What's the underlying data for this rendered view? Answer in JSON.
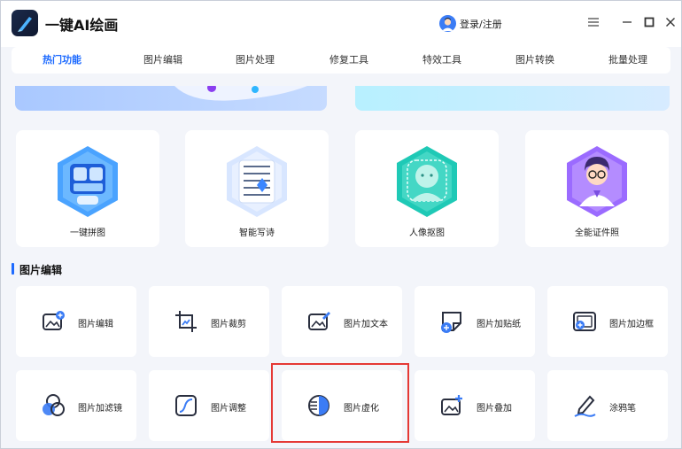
{
  "app": {
    "title": "一键AI绘画",
    "login_label": "登录/注册"
  },
  "nav": {
    "tabs": [
      {
        "label": "热门功能"
      },
      {
        "label": "图片编辑"
      },
      {
        "label": "图片处理"
      },
      {
        "label": "修复工具"
      },
      {
        "label": "特效工具"
      },
      {
        "label": "图片转换"
      },
      {
        "label": "批量处理"
      }
    ],
    "active_index": 0
  },
  "features": [
    {
      "label": "一键拼图",
      "icon": "collage-icon"
    },
    {
      "label": "智能写诗",
      "icon": "poem-icon"
    },
    {
      "label": "人像抠图",
      "icon": "portrait-cutout-icon"
    },
    {
      "label": "全能证件照",
      "icon": "id-photo-icon"
    }
  ],
  "section": {
    "title": "图片编辑"
  },
  "tools": [
    {
      "label": "图片编辑",
      "icon": "image-edit-icon"
    },
    {
      "label": "图片裁剪",
      "icon": "crop-icon"
    },
    {
      "label": "图片加文本",
      "icon": "add-text-icon"
    },
    {
      "label": "图片加贴纸",
      "icon": "sticker-icon"
    },
    {
      "label": "图片加边框",
      "icon": "frame-icon"
    },
    {
      "label": "图片加滤镜",
      "icon": "filter-icon"
    },
    {
      "label": "图片调整",
      "icon": "adjust-icon"
    },
    {
      "label": "图片虚化",
      "icon": "blur-icon"
    },
    {
      "label": "图片叠加",
      "icon": "overlay-icon"
    },
    {
      "label": "涂鸦笔",
      "icon": "doodle-pen-icon"
    }
  ],
  "colors": {
    "accent": "#1e6bff",
    "highlight": "#e53935",
    "icon_dark": "#2a2f3f"
  }
}
